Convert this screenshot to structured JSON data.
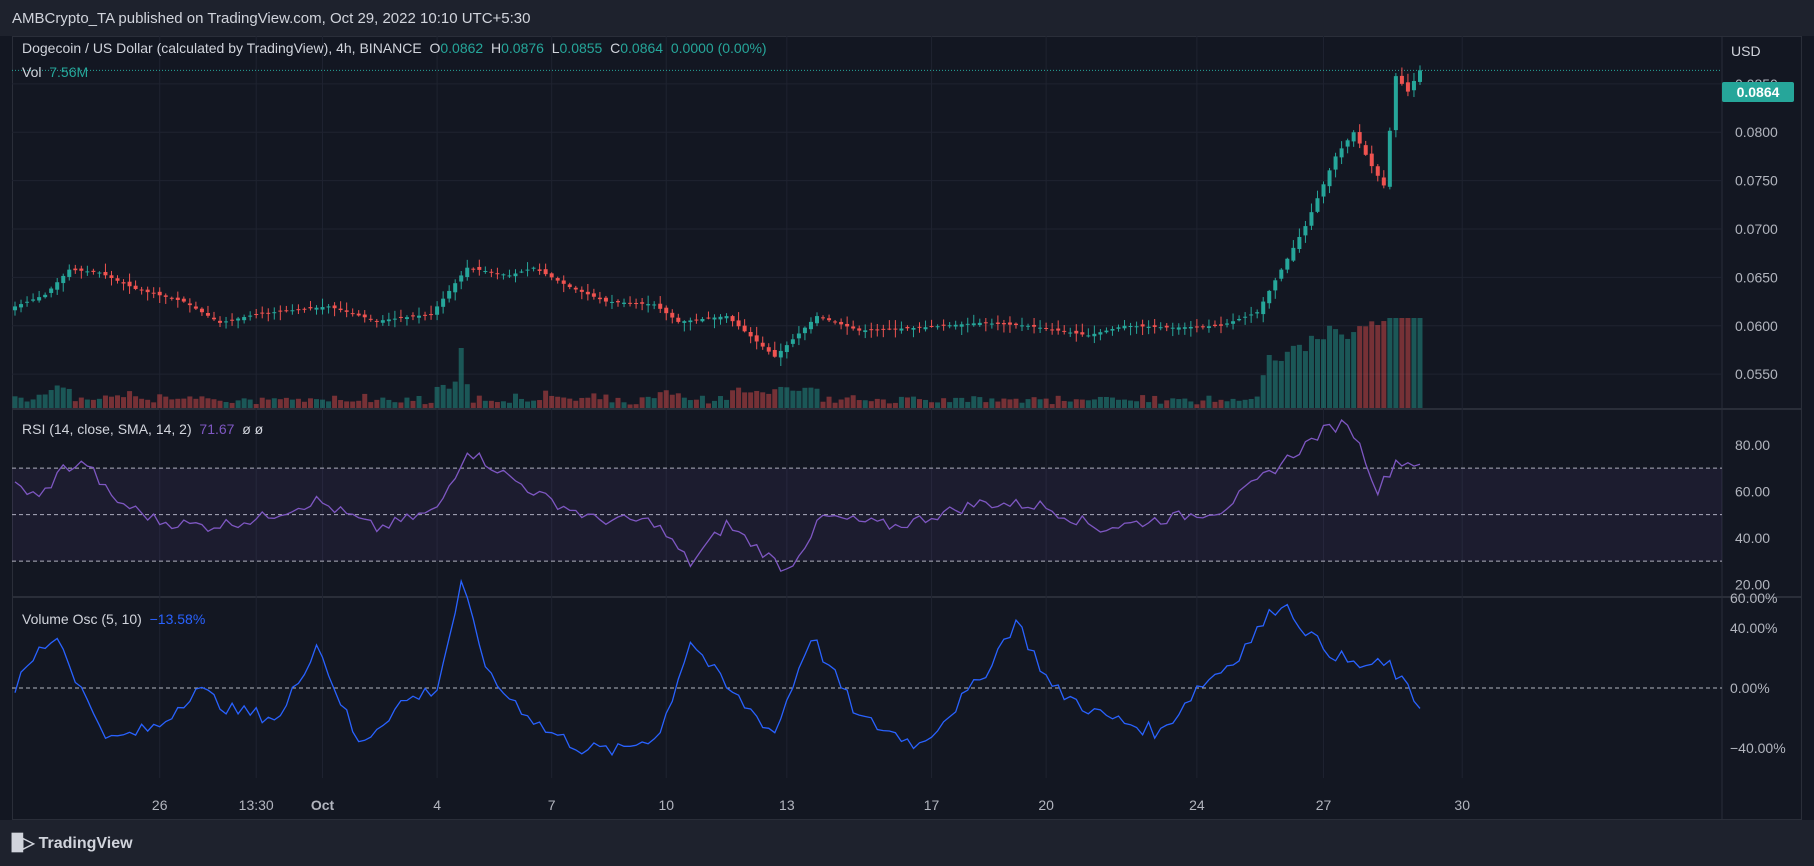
{
  "header": {
    "published": "AMBCrypto_TA published on TradingView.com, Oct 29, 2022 10:10 UTC+5:30"
  },
  "footer": {
    "brand": "TradingView",
    "logo": "tv-logo-icon"
  },
  "colors": {
    "background": "#131722",
    "up": "#26a69a",
    "down": "#ef5350",
    "rsi": "#7e57c2",
    "volume_osc": "#2962ff",
    "grid": "#1f2330"
  },
  "main_legend": {
    "symbol": "Dogecoin / US Dollar (calculated by TradingView), 4h, BINANCE",
    "o_label": "O",
    "o_value": "0.0862",
    "h_label": "H",
    "h_value": "0.0876",
    "l_label": "L",
    "l_value": "0.0855",
    "c_label": "C",
    "c_value": "0.0864",
    "change": "0.0000 (0.00%)",
    "vol_label": "Vol",
    "vol_value": "7.56M"
  },
  "rsi_legend": {
    "label": "RSI (14, close, SMA, 14, 2)",
    "value": "71.67",
    "extra": "ø  ø"
  },
  "vosc_legend": {
    "label": "Volume Osc (5, 10)",
    "value": "−13.58%"
  },
  "price_axis": {
    "currency": "USD",
    "current_price": "0.0864",
    "ticks": [
      "0.0850",
      "0.0800",
      "0.0750",
      "0.0700",
      "0.0650",
      "0.0600",
      "0.0550"
    ]
  },
  "rsi_axis": {
    "ticks": [
      "80.00",
      "60.00",
      "40.00",
      "20.00"
    ]
  },
  "vosc_axis": {
    "ticks": [
      "60.00%",
      "40.00%",
      "0.00%",
      "−40.00%"
    ]
  },
  "time_axis": {
    "labels": [
      "26",
      "13:30",
      "Oct",
      "4",
      "7",
      "10",
      "13",
      "17",
      "20",
      "24",
      "27",
      "30"
    ]
  },
  "chart_data": [
    {
      "type": "candlestick",
      "title": "Dogecoin / US Dollar (calculated by TradingView), 4h, BINANCE",
      "interval": "4h",
      "ylabel": "USD",
      "ylim": [
        0.0515,
        0.0885
      ],
      "ohlc_anchors": [
        {
          "t": 0,
          "close": 0.062
        },
        {
          "t": 5,
          "close": 0.0632
        },
        {
          "t": 9,
          "close": 0.0658
        },
        {
          "t": 14,
          "close": 0.0655
        },
        {
          "t": 20,
          "close": 0.0638
        },
        {
          "t": 28,
          "close": 0.0625
        },
        {
          "t": 34,
          "close": 0.0603
        },
        {
          "t": 40,
          "close": 0.0612
        },
        {
          "t": 52,
          "close": 0.062
        },
        {
          "t": 60,
          "close": 0.0605
        },
        {
          "t": 69,
          "close": 0.0612
        },
        {
          "t": 75,
          "close": 0.066
        },
        {
          "t": 82,
          "close": 0.0652
        },
        {
          "t": 86,
          "close": 0.066
        },
        {
          "t": 92,
          "close": 0.064
        },
        {
          "t": 98,
          "close": 0.0625
        },
        {
          "t": 106,
          "close": 0.0622
        },
        {
          "t": 110,
          "close": 0.0604
        },
        {
          "t": 118,
          "close": 0.061
        },
        {
          "t": 126,
          "close": 0.0568
        },
        {
          "t": 133,
          "close": 0.061
        },
        {
          "t": 140,
          "close": 0.0595
        },
        {
          "t": 150,
          "close": 0.0598
        },
        {
          "t": 160,
          "close": 0.0603
        },
        {
          "t": 168,
          "close": 0.06
        },
        {
          "t": 178,
          "close": 0.059
        },
        {
          "t": 184,
          "close": 0.06
        },
        {
          "t": 192,
          "close": 0.0598
        },
        {
          "t": 200,
          "close": 0.06
        },
        {
          "t": 206,
          "close": 0.0614
        },
        {
          "t": 210,
          "close": 0.0658
        },
        {
          "t": 214,
          "close": 0.0703
        },
        {
          "t": 219,
          "close": 0.0775
        },
        {
          "t": 222,
          "close": 0.08
        },
        {
          "t": 225,
          "close": 0.0765
        },
        {
          "t": 227,
          "close": 0.0745
        },
        {
          "t": 229,
          "close": 0.0858
        },
        {
          "t": 231,
          "close": 0.0842
        },
        {
          "t": 233,
          "close": 0.0864
        }
      ]
    },
    {
      "type": "line",
      "title": "RSI (14, close, SMA, 14, 2)",
      "ylim": [
        15,
        95
      ],
      "bands": [
        30,
        50,
        70
      ],
      "last_value": 71.67,
      "anchors": [
        {
          "t": 0,
          "v": 63
        },
        {
          "t": 4,
          "v": 57
        },
        {
          "t": 8,
          "v": 70
        },
        {
          "t": 12,
          "v": 72
        },
        {
          "t": 16,
          "v": 57
        },
        {
          "t": 24,
          "v": 47
        },
        {
          "t": 32,
          "v": 45
        },
        {
          "t": 40,
          "v": 48
        },
        {
          "t": 50,
          "v": 56
        },
        {
          "t": 60,
          "v": 44
        },
        {
          "t": 70,
          "v": 52
        },
        {
          "t": 75,
          "v": 78
        },
        {
          "t": 82,
          "v": 66
        },
        {
          "t": 88,
          "v": 57
        },
        {
          "t": 96,
          "v": 48
        },
        {
          "t": 106,
          "v": 47
        },
        {
          "t": 112,
          "v": 29
        },
        {
          "t": 118,
          "v": 46
        },
        {
          "t": 128,
          "v": 26
        },
        {
          "t": 134,
          "v": 49
        },
        {
          "t": 146,
          "v": 45
        },
        {
          "t": 160,
          "v": 55
        },
        {
          "t": 170,
          "v": 54
        },
        {
          "t": 180,
          "v": 44
        },
        {
          "t": 190,
          "v": 48
        },
        {
          "t": 200,
          "v": 52
        },
        {
          "t": 210,
          "v": 72
        },
        {
          "t": 217,
          "v": 86
        },
        {
          "t": 221,
          "v": 90
        },
        {
          "t": 224,
          "v": 74
        },
        {
          "t": 226,
          "v": 60
        },
        {
          "t": 229,
          "v": 73
        },
        {
          "t": 233,
          "v": 71.67
        }
      ]
    },
    {
      "type": "line",
      "title": "Volume Osc (5, 10)",
      "ylim": [
        -60,
        60
      ],
      "zero_line": 0,
      "last_value": -13.58,
      "anchors": [
        {
          "t": 0,
          "v": 0
        },
        {
          "t": 4,
          "v": 25
        },
        {
          "t": 7,
          "v": 35
        },
        {
          "t": 12,
          "v": -10
        },
        {
          "t": 16,
          "v": -35
        },
        {
          "t": 24,
          "v": -25
        },
        {
          "t": 30,
          "v": 0
        },
        {
          "t": 36,
          "v": -15
        },
        {
          "t": 44,
          "v": -20
        },
        {
          "t": 50,
          "v": 30
        },
        {
          "t": 57,
          "v": -38
        },
        {
          "t": 64,
          "v": -10
        },
        {
          "t": 70,
          "v": 0
        },
        {
          "t": 74,
          "v": 68
        },
        {
          "t": 79,
          "v": 5
        },
        {
          "t": 88,
          "v": -28
        },
        {
          "t": 94,
          "v": -40
        },
        {
          "t": 100,
          "v": -42
        },
        {
          "t": 107,
          "v": -30
        },
        {
          "t": 112,
          "v": 32
        },
        {
          "t": 118,
          "v": 0
        },
        {
          "t": 126,
          "v": -30
        },
        {
          "t": 132,
          "v": 35
        },
        {
          "t": 140,
          "v": -20
        },
        {
          "t": 150,
          "v": -38
        },
        {
          "t": 160,
          "v": 5
        },
        {
          "t": 166,
          "v": 45
        },
        {
          "t": 172,
          "v": 0
        },
        {
          "t": 180,
          "v": -18
        },
        {
          "t": 190,
          "v": -30
        },
        {
          "t": 196,
          "v": 0
        },
        {
          "t": 202,
          "v": 18
        },
        {
          "t": 210,
          "v": 58
        },
        {
          "t": 216,
          "v": 30
        },
        {
          "t": 222,
          "v": 15
        },
        {
          "t": 228,
          "v": 15
        },
        {
          "t": 233,
          "v": -13.58
        }
      ]
    }
  ]
}
